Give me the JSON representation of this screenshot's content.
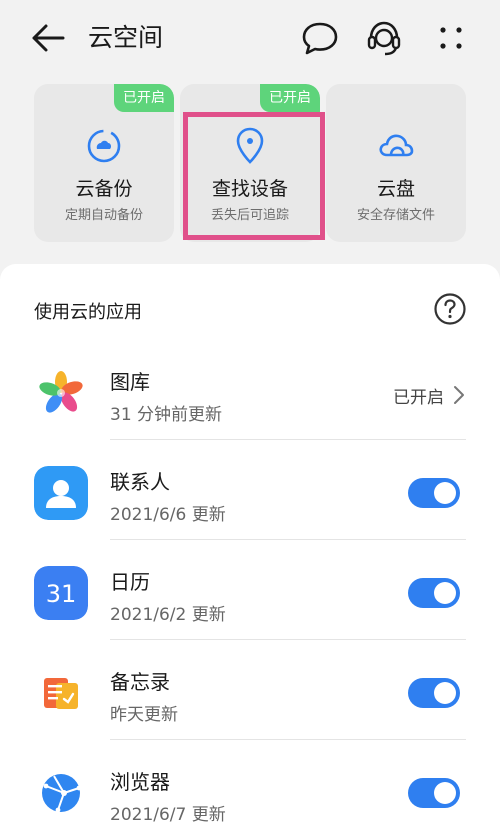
{
  "header": {
    "title": "云空间",
    "icons": [
      "back-arrow-icon",
      "message-icon",
      "headset-support-icon",
      "more-dots-icon"
    ]
  },
  "features": [
    {
      "title": "云备份",
      "subtitle": "定期自动备份",
      "badge": "已开启",
      "icon": "cloud-sync-icon"
    },
    {
      "title": "查找设备",
      "subtitle": "丢失后可追踪",
      "badge": "已开启",
      "icon": "location-pin-icon",
      "highlighted": true
    },
    {
      "title": "云盘",
      "subtitle": "安全存储文件",
      "badge": "",
      "icon": "cloud-drive-icon"
    }
  ],
  "apps_section": {
    "title": "使用云的应用",
    "help_icon": "question-circle-icon",
    "items": [
      {
        "name": "图库",
        "subtitle": "31 分钟前更新",
        "status": "已开启",
        "control": "chevron"
      },
      {
        "name": "联系人",
        "subtitle": "2021/6/6 更新",
        "control": "toggle",
        "enabled": true
      },
      {
        "name": "日历",
        "subtitle": "2021/6/2 更新",
        "icon_text": "31",
        "control": "toggle",
        "enabled": true
      },
      {
        "name": "备忘录",
        "subtitle": "昨天更新",
        "control": "toggle",
        "enabled": true
      },
      {
        "name": "浏览器",
        "subtitle": "2021/6/7 更新",
        "control": "toggle",
        "enabled": true
      }
    ]
  },
  "colors": {
    "accent_blue": "#2f7ff0",
    "badge_green": "#5ed47b",
    "highlight_pink": "#e0508a",
    "background": "#f2f2f2"
  }
}
